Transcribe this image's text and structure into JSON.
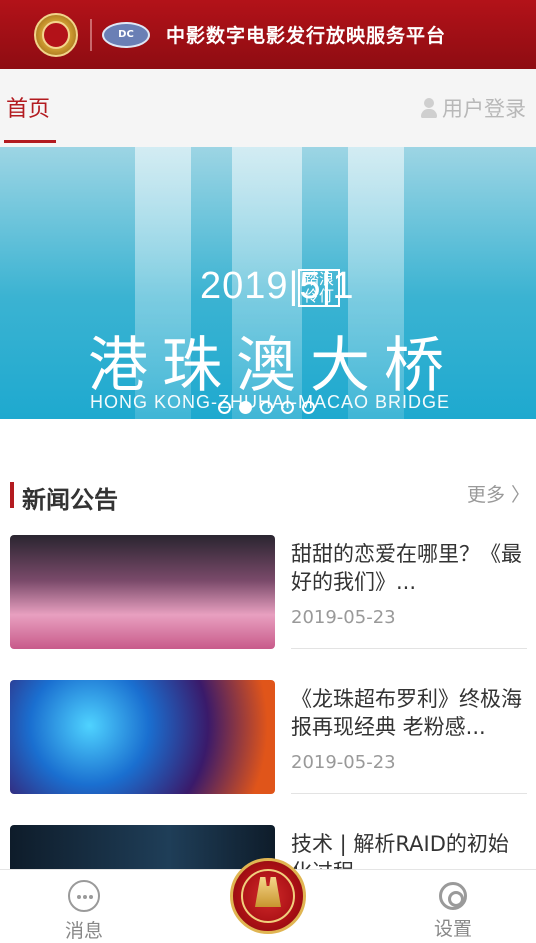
{
  "header": {
    "logo_text": "",
    "badge_text": "DC",
    "title": "中影数字电影发行放映服务平台"
  },
  "nav": {
    "home_tab": "首页",
    "login_label": "用户登录"
  },
  "banner": {
    "date_text": "2019|5|1",
    "tag_text": "踏浪伶仃",
    "title": "港珠澳大桥",
    "subtitle": "HONG KONG-ZHUHAI-MACAO BRIDGE",
    "slides_total": 5,
    "active_slide": 1
  },
  "news_section": {
    "title": "新闻公告",
    "more_label": "更多 〉",
    "items": [
      {
        "title": "甜甜的恋爱在哪里？《最好的我们》...",
        "date": "2019-05-23"
      },
      {
        "title": "《龙珠超布罗利》终极海报再现经典 老粉感...",
        "date": "2019-05-23"
      },
      {
        "title": "技术 | 解析RAID的初始化过程",
        "date": ""
      }
    ]
  },
  "bottom_nav": {
    "messages_label": "消息",
    "settings_label": "设置"
  },
  "colors": {
    "brand_red": "#b31b20",
    "banner_blue": "#2cb0d2"
  }
}
